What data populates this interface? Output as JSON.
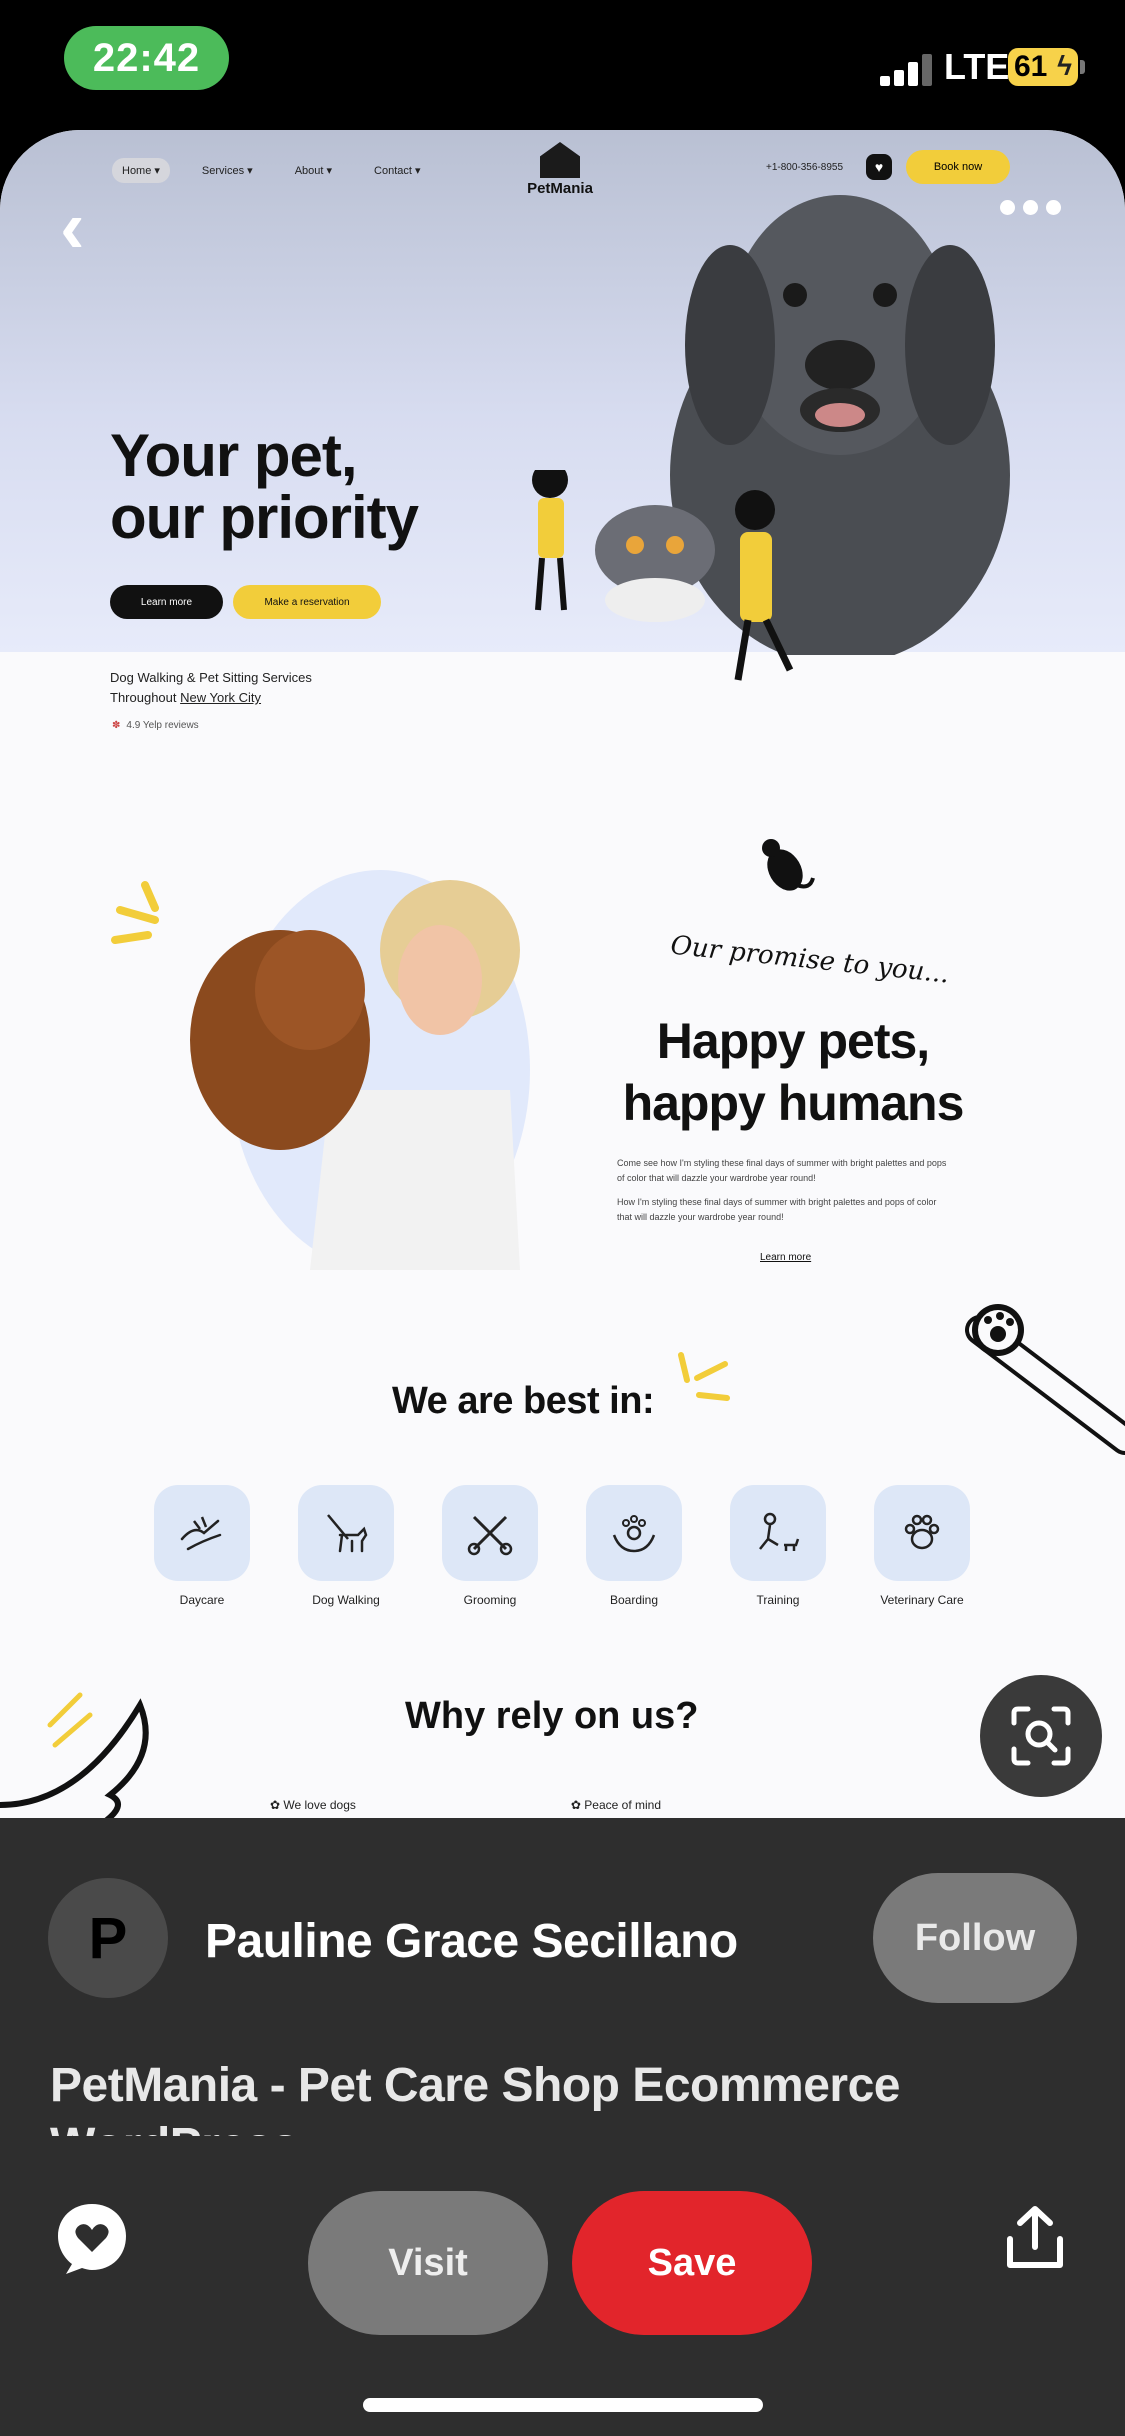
{
  "status_bar": {
    "time": "22:42",
    "network": "LTE",
    "battery": "61"
  },
  "pin_image": {
    "nav": {
      "items": [
        "Home ▾",
        "Services ▾",
        "About ▾",
        "Contact ▾"
      ],
      "logo": "PetMania",
      "phone": "+1-800-356-8955",
      "book_label": "Book now"
    },
    "hero": {
      "title_line1": "Your pet,",
      "title_line2": "our priority",
      "learn_more": "Learn more",
      "reservation": "Make a reservation",
      "tagline_line1": "Dog Walking & Pet Sitting Services",
      "tagline_prefix": "Throughout ",
      "tagline_link": "New York City",
      "reviews": "4.9 Yelp reviews"
    },
    "promise": {
      "kicker": "Our promise to you...",
      "title_line1": "Happy pets,",
      "title_line2": "happy humans",
      "para1": "Come see how I'm styling these final days of summer with bright palettes and pops of color that will dazzle your wardrobe year round!",
      "para2": "How I'm styling these final days of summer with bright palettes and pops of color that will dazzle your wardrobe year round!",
      "learn_more": "Learn more"
    },
    "best": {
      "title": "We are best in:",
      "services": [
        {
          "label": "Daycare",
          "icon": "hands-icon"
        },
        {
          "label": "Dog Walking",
          "icon": "dog-walking-icon"
        },
        {
          "label": "Grooming",
          "icon": "scissors-comb-icon"
        },
        {
          "label": "Boarding",
          "icon": "paw-hands-icon"
        },
        {
          "label": "Training",
          "icon": "training-icon"
        },
        {
          "label": "Veterinary Care",
          "icon": "paw-icon"
        }
      ]
    },
    "why": {
      "title": "Why rely on us?",
      "items": [
        "We love dogs",
        "Peace of mind"
      ]
    }
  },
  "sheet": {
    "avatar_letter": "P",
    "author": "Pauline Grace Secillano",
    "follow": "Follow",
    "title": "PetMania - Pet Care Shop Ecommerce WordPress",
    "visit": "Visit",
    "save": "Save"
  },
  "colors": {
    "accent_yellow": "#f2cd3a",
    "save_red": "#e2252b",
    "sheet_bg": "#2e2e2e",
    "time_pill": "#4cbb5a"
  }
}
